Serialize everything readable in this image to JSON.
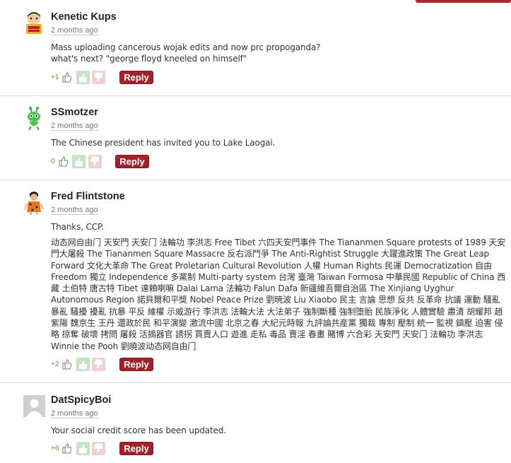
{
  "comments": [
    {
      "author": "Kenetic Kups",
      "time": "2 months ago",
      "text": "Mass uploading cancerous wojak edits and now prc propoganda?\nwhat's next? \"george floyd kneeled on himself\"",
      "score": "+1",
      "avatar_icon": "cartoon-avatar-icon"
    },
    {
      "author": "SSmotzer",
      "time": "2 months ago",
      "text": "The Chinese president has invited you to Lake Laogai.",
      "score": "0",
      "avatar_icon": "green-alien-avatar-icon"
    },
    {
      "author": "Fred Flintstone",
      "time": "2 months ago",
      "text": "Thanks, CCP.",
      "text2": "动态网自由门 天安門 天安门 法輪功 李洪志 Free Tibet 六四天安門事件 The Tiananmen Square protests of 1989 天安門大屠殺 The Tiananmen Square Massacre 反右派鬥爭 The Anti-Rightist Struggle 大躍進政策 The Great Leap Forward 文化大革命 The Great Proletarian Cultural Revolution 人權 Human Rights 民運 Democratization 自由 Freedom 獨立 Independence 多黨制 Multi-party system 台灣 臺灣 Taiwan Formosa 中華民國 Republic of China 西藏 土伯特 唐古特 Tibet 達賴喇嘛 Dalai Lama 法輪功 Falun Dafa 新疆維吾爾自治區 The Xinjiang Uyghur Autonomous Region 諾貝爾和平獎 Nobel Peace Prize 劉暁波 Liu Xiaobo 民主 言論 思想 反共 反革命 抗議 運動 騷亂 暴亂 騷擾 擾亂 抗暴 平反 維權 示威游行 李洪志 法輪大法 大法弟子 強制斷種 強制堕胎 民族淨化 人體實驗 肅清 胡耀邦 趙紫陽 魏京生 王丹 還政於民 和平演變 激流中國 北京之春 大紀元時報 九評論共産黨 獨裁 專制 壓制 統一 監視 鎮壓 迫害 侵略 掠奪 破壞 拷問 屠殺 活摘器官 誘拐 買賣人口 遊進 走私 毒品 賣淫 春畫 賭博 六合彩 天安門 天安门 法輪功 李洪志 Winnie the Pooh 劉曉波动态网自由门",
      "score": "+2",
      "avatar_icon": "caveman-avatar-icon"
    },
    {
      "author": "DatSpicyBoi",
      "time": "2 months ago",
      "text": "Your social credit score has been updated.",
      "score": "+6",
      "avatar_icon": "default-user-avatar-icon"
    }
  ],
  "reply_label": "Reply",
  "colors": {
    "reply_bg": "#a3212b",
    "upvote_bg": "#c6e3c6",
    "downvote_bg": "#eed2d2",
    "score_green": "#4a9e2f"
  }
}
